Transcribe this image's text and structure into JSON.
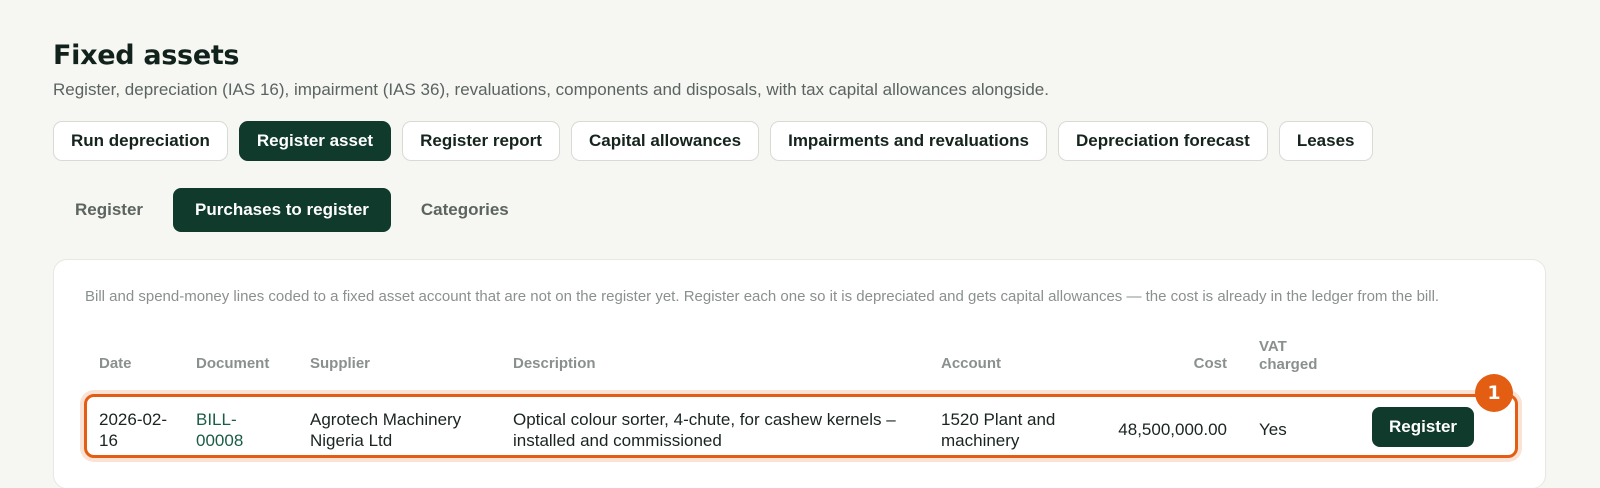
{
  "header": {
    "title": "Fixed assets",
    "subtitle": "Register, depreciation (IAS 16), impairment (IAS 36), revaluations, components and disposals, with tax capital allowances alongside."
  },
  "toolbar": {
    "buttons": [
      {
        "label": "Run depreciation",
        "active": false
      },
      {
        "label": "Register asset",
        "active": true
      },
      {
        "label": "Register report",
        "active": false
      },
      {
        "label": "Capital allowances",
        "active": false
      },
      {
        "label": "Impairments and revaluations",
        "active": false
      },
      {
        "label": "Depreciation forecast",
        "active": false
      },
      {
        "label": "Leases",
        "active": false
      }
    ]
  },
  "subtabs": [
    {
      "label": "Register",
      "active": false
    },
    {
      "label": "Purchases to register",
      "active": true
    },
    {
      "label": "Categories",
      "active": false
    }
  ],
  "panel": {
    "note": "Bill and spend-money lines coded to a fixed asset account that are not on the register yet. Register each one so it is depreciated and gets capital allowances — the cost is already in the ledger from the bill.",
    "columns": {
      "date": "Date",
      "document": "Document",
      "supplier": "Supplier",
      "description": "Description",
      "account": "Account",
      "cost": "Cost",
      "vat": "VAT charged"
    },
    "rows": [
      {
        "date": "2026-02-16",
        "document": "BILL-00008",
        "supplier": "Agrotech Machinery Nigeria Ltd",
        "description": "Optical colour sorter, 4-chute, for cashew kernels – installed and commissioned",
        "account": "1520 Plant and machinery",
        "cost": "48,500,000.00",
        "vat_charged": "Yes",
        "action_label": "Register"
      }
    ]
  },
  "annotation": {
    "marker": "1",
    "color": "#e35d13"
  },
  "colors": {
    "accent": "#0f3a2c",
    "highlight": "#e35d13",
    "background": "#f6f6f2"
  }
}
